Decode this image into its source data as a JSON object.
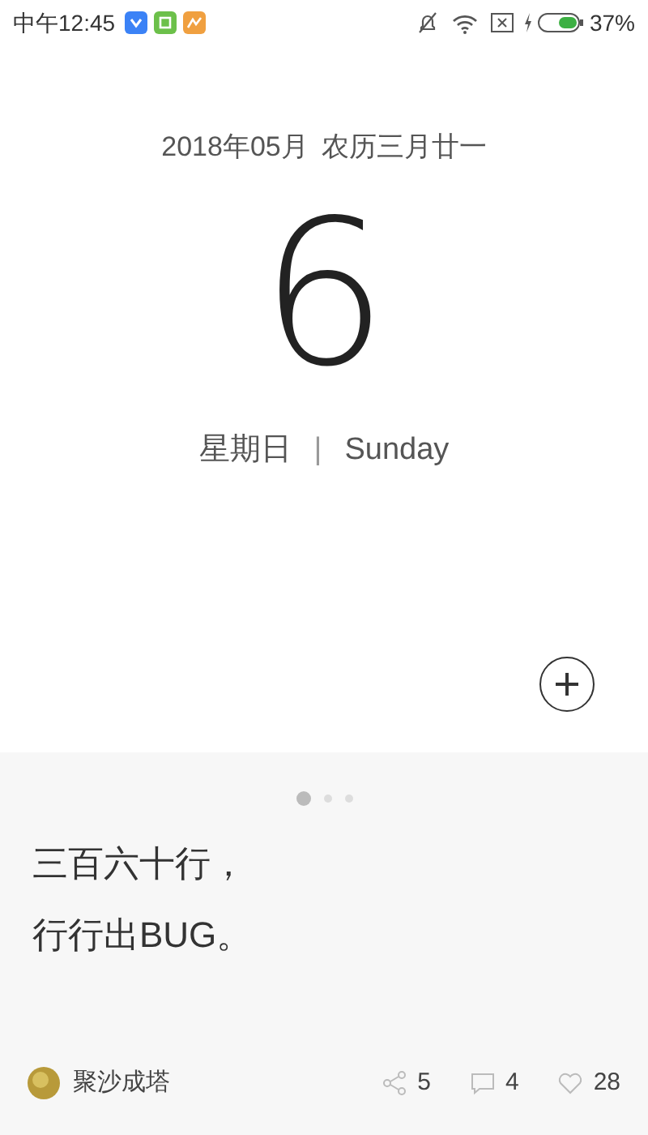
{
  "status_bar": {
    "time": "中午12:45",
    "battery": "37%"
  },
  "date": {
    "month": "2018年05月",
    "lunar": "农历三月廿一",
    "day": "6",
    "weekday_cn": "星期日",
    "separator": "|",
    "weekday_en": "Sunday"
  },
  "pager": [
    {
      "selected": true
    },
    {
      "selected": false
    },
    {
      "selected": false
    }
  ],
  "quote": {
    "lines": [
      "三百六十行，",
      "行行出BUG。"
    ]
  },
  "footer": {
    "author": "聚沙成塔",
    "stats": [
      {
        "kind": "share",
        "count": "5"
      },
      {
        "kind": "comment",
        "count": "4"
      },
      {
        "kind": "like",
        "count": "28"
      }
    ]
  }
}
